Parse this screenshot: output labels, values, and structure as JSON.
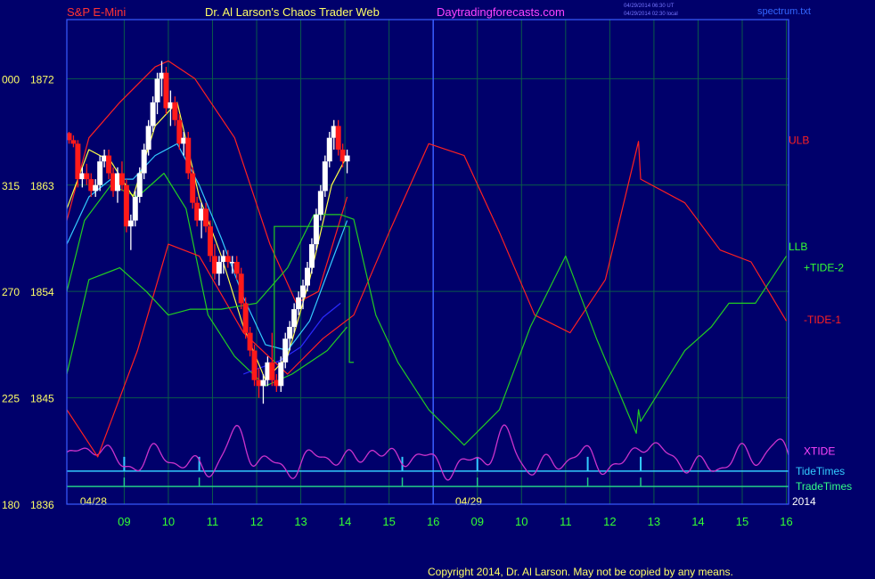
{
  "header": {
    "symbol": "S&P E-Mini",
    "title": "Dr. Al Larson's Chaos Trader Web",
    "site": "Daytradingforecasts.com",
    "timestamp_line1": "04/29/2014 06:30 UT",
    "timestamp_line2": "04/29/2014 02:30 local",
    "filename": "spectrum.txt"
  },
  "footer": {
    "copyright": "Copyright 2014, Dr. Al Larson. May not be copied by any means."
  },
  "colors": {
    "background": "#00006b",
    "frame": "#3a5cff",
    "grid": "#0a5a4a",
    "up_bar": "#ffffff",
    "down_bar": "#ff1a1a",
    "ulb": "#ff2020",
    "llb": "#22cc22",
    "tide": "#2a2aff",
    "xtide": "#cc33cc",
    "tidetimes": "#33ccff",
    "tradetimes": "#22cc88",
    "ma_fast": "#ffff44",
    "ma_mid": "#33ccff",
    "label_yellow": "#ffff66",
    "label_green": "#33ff33"
  },
  "chart_data": {
    "type": "line",
    "title": "S&P E-Mini",
    "y_axis": {
      "ticks": [
        {
          "code": "000",
          "price": 1872
        },
        {
          "code": "315",
          "price": 1863
        },
        {
          "code": "270",
          "price": 1854
        },
        {
          "code": "225",
          "price": 1845
        },
        {
          "code": "180",
          "price": 1836
        }
      ],
      "ylim": [
        1836,
        1877
      ]
    },
    "x_axis": {
      "hour_ticks": [
        {
          "label": "09",
          "t": 1.3
        },
        {
          "label": "10",
          "t": 2.3
        },
        {
          "label": "11",
          "t": 3.3
        },
        {
          "label": "12",
          "t": 4.3
        },
        {
          "label": "13",
          "t": 5.3
        },
        {
          "label": "14",
          "t": 6.3
        },
        {
          "label": "15",
          "t": 7.3
        },
        {
          "label": "16",
          "t": 8.3
        },
        {
          "label": "09",
          "t": 9.3
        },
        {
          "label": "10",
          "t": 10.3
        },
        {
          "label": "11",
          "t": 11.3
        },
        {
          "label": "12",
          "t": 12.3
        },
        {
          "label": "13",
          "t": 13.3
        },
        {
          "label": "14",
          "t": 14.3
        },
        {
          "label": "15",
          "t": 15.3
        },
        {
          "label": "16",
          "t": 16.3
        }
      ],
      "date_labels": [
        {
          "label": "04/28",
          "t": 0.3
        },
        {
          "label": "04/29",
          "t": 8.8
        }
      ],
      "year_label": "2014",
      "session_break_t": 8.3,
      "xlim": [
        0,
        16.35
      ]
    },
    "legend": [
      {
        "name": "ULB",
        "color": "#ff2020",
        "price": 1866.8
      },
      {
        "name": "LLB",
        "color": "#33ff33",
        "price": 1857.8
      },
      {
        "name": "+TIDE-2",
        "color": "#33ff33",
        "price": 1856.0
      },
      {
        "name": "-TIDE-1",
        "color": "#ff2020",
        "price": 1851.6
      },
      {
        "name": "XTIDE",
        "color": "#ff44ff",
        "price": 1840.5
      },
      {
        "name": "TideTimes",
        "color": "#33ccff",
        "price": 1838.8
      },
      {
        "name": "TradeTimes",
        "color": "#33ff88",
        "price": 1837.5
      }
    ],
    "price_bars": [
      [
        0.05,
        1867.5,
        1866.5,
        1867.4,
        1866.8
      ],
      [
        0.15,
        1867.2,
        1866.2,
        1866.8,
        1866.5
      ],
      [
        0.25,
        1866.8,
        1862.8,
        1866.5,
        1863.5
      ],
      [
        0.35,
        1864.5,
        1862.8,
        1863.5,
        1864.0
      ],
      [
        0.45,
        1864.8,
        1863.0,
        1864.0,
        1863.5
      ],
      [
        0.55,
        1864.0,
        1862.0,
        1863.5,
        1862.5
      ],
      [
        0.65,
        1863.5,
        1862.0,
        1862.5,
        1863.0
      ],
      [
        0.75,
        1865.5,
        1862.5,
        1863.0,
        1865.0
      ],
      [
        0.85,
        1866.0,
        1864.5,
        1865.0,
        1865.5
      ],
      [
        0.95,
        1866.0,
        1863.5,
        1865.5,
        1864.0
      ],
      [
        1.05,
        1864.5,
        1862.0,
        1864.0,
        1862.5
      ],
      [
        1.15,
        1864.5,
        1861.5,
        1862.5,
        1864.0
      ],
      [
        1.25,
        1865.0,
        1862.5,
        1864.0,
        1863.0
      ],
      [
        1.35,
        1863.5,
        1859.0,
        1863.0,
        1859.5
      ],
      [
        1.45,
        1860.5,
        1857.5,
        1859.5,
        1860.0
      ],
      [
        1.55,
        1862.5,
        1859.5,
        1860.0,
        1862.0
      ],
      [
        1.65,
        1864.5,
        1861.5,
        1862.0,
        1864.0
      ],
      [
        1.75,
        1866.5,
        1863.5,
        1864.0,
        1866.0
      ],
      [
        1.85,
        1868.5,
        1865.5,
        1866.0,
        1868.0
      ],
      [
        1.95,
        1870.5,
        1867.5,
        1868.0,
        1870.0
      ],
      [
        2.05,
        1872.5,
        1869.0,
        1870.0,
        1872.0
      ],
      [
        2.15,
        1873.5,
        1870.5,
        1872.0,
        1872.5
      ],
      [
        2.25,
        1873.0,
        1869.0,
        1872.5,
        1869.5
      ],
      [
        2.35,
        1871.0,
        1868.0,
        1869.5,
        1870.0
      ],
      [
        2.45,
        1870.5,
        1868.0,
        1870.0,
        1868.5
      ],
      [
        2.55,
        1869.0,
        1866.0,
        1868.5,
        1866.5
      ],
      [
        2.65,
        1867.5,
        1865.5,
        1866.5,
        1867.0
      ],
      [
        2.75,
        1867.5,
        1863.5,
        1867.0,
        1864.0
      ],
      [
        2.85,
        1864.5,
        1861.0,
        1864.0,
        1861.5
      ],
      [
        2.95,
        1862.0,
        1859.5,
        1861.5,
        1860.0
      ],
      [
        3.05,
        1861.5,
        1858.5,
        1860.0,
        1861.0
      ],
      [
        3.15,
        1861.5,
        1859.0,
        1861.0,
        1859.5
      ],
      [
        3.25,
        1860.0,
        1856.5,
        1859.5,
        1857.0
      ],
      [
        3.35,
        1858.0,
        1855.0,
        1857.0,
        1855.5
      ],
      [
        3.45,
        1857.0,
        1854.5,
        1855.5,
        1856.5
      ],
      [
        3.55,
        1857.5,
        1855.5,
        1856.5,
        1857.0
      ],
      [
        3.65,
        1857.5,
        1856.0,
        1857.0,
        1856.5
      ],
      [
        3.75,
        1857.0,
        1855.5,
        1856.5,
        1856.5
      ],
      [
        3.85,
        1857.0,
        1855.0,
        1856.5,
        1855.5
      ],
      [
        3.95,
        1856.0,
        1852.5,
        1855.5,
        1853.0
      ],
      [
        4.05,
        1853.5,
        1850.0,
        1853.0,
        1850.5
      ],
      [
        4.15,
        1851.0,
        1848.5,
        1850.5,
        1849.0
      ],
      [
        4.25,
        1849.5,
        1846.0,
        1849.0,
        1846.5
      ],
      [
        4.35,
        1847.5,
        1845.0,
        1846.5,
        1846.0
      ],
      [
        4.45,
        1847.0,
        1844.5,
        1846.0,
        1846.5
      ],
      [
        4.55,
        1848.5,
        1846.0,
        1846.5,
        1848.0
      ],
      [
        4.65,
        1850.5,
        1846.0,
        1848.0,
        1846.5
      ],
      [
        4.75,
        1847.0,
        1845.5,
        1846.5,
        1846.0
      ],
      [
        4.85,
        1848.5,
        1845.5,
        1846.0,
        1848.0
      ],
      [
        4.95,
        1850.5,
        1847.5,
        1848.0,
        1850.0
      ],
      [
        5.05,
        1851.5,
        1849.0,
        1850.0,
        1851.0
      ],
      [
        5.15,
        1853.0,
        1850.5,
        1851.0,
        1852.5
      ],
      [
        5.25,
        1854.0,
        1852.0,
        1852.5,
        1853.5
      ],
      [
        5.35,
        1855.0,
        1852.5,
        1853.5,
        1854.5
      ],
      [
        5.45,
        1856.5,
        1854.0,
        1854.5,
        1856.0
      ],
      [
        5.55,
        1858.5,
        1855.5,
        1856.0,
        1858.0
      ],
      [
        5.65,
        1861.0,
        1857.5,
        1858.0,
        1860.5
      ],
      [
        5.75,
        1863.0,
        1860.0,
        1860.5,
        1862.5
      ],
      [
        5.85,
        1865.5,
        1862.0,
        1862.5,
        1865.0
      ],
      [
        5.95,
        1867.5,
        1864.5,
        1865.0,
        1867.0
      ],
      [
        6.05,
        1868.5,
        1866.0,
        1867.0,
        1868.0
      ],
      [
        6.15,
        1868.5,
        1865.5,
        1868.0,
        1866.0
      ],
      [
        6.25,
        1866.5,
        1864.5,
        1866.0,
        1865.0
      ],
      [
        6.35,
        1866.0,
        1864.0,
        1865.0,
        1865.5
      ]
    ],
    "series": [
      {
        "name": "ULB",
        "color": "#ff2020",
        "x": [
          0,
          0.5,
          1.2,
          2.0,
          2.3,
          2.9,
          3.8,
          4.6,
          5.2,
          5.7,
          6.35
        ],
        "y": [
          1860,
          1867,
          1870,
          1873,
          1873.5,
          1872,
          1867,
          1858,
          1853,
          1854,
          1862
        ]
      },
      {
        "name": "LLB",
        "color": "#22cc22",
        "x": [
          0,
          0.4,
          1.0,
          1.6,
          2.2,
          2.7,
          3.2,
          3.8,
          4.5,
          5.1,
          5.9,
          6.35
        ],
        "y": [
          1854,
          1860,
          1863,
          1862,
          1864,
          1861,
          1852,
          1848.5,
          1846,
          1847,
          1849,
          1851
        ]
      },
      {
        "name": "Projection",
        "color": "#2a2aff",
        "x": [
          4.0,
          4.2,
          4.8,
          5.3,
          5.8,
          6.2
        ],
        "y": [
          1847,
          1847.3,
          1848.1,
          1849.3,
          1851.8,
          1853.0
        ]
      },
      {
        "name": "MA-fast",
        "color": "#ffff44",
        "x": [
          0,
          0.5,
          1.0,
          1.5,
          2.0,
          2.5,
          3.0,
          3.5,
          4.0,
          4.5,
          5.0,
          5.5,
          6.0,
          6.35
        ],
        "y": [
          1861,
          1866,
          1865,
          1862,
          1868,
          1870,
          1862,
          1857,
          1851,
          1846.5,
          1848.5,
          1855,
          1863,
          1865.5
        ]
      },
      {
        "name": "MA-mid",
        "color": "#33ccff",
        "x": [
          0,
          0.5,
          1.0,
          1.5,
          2.0,
          2.5,
          3.0,
          3.5,
          4.0,
          4.5,
          5.0,
          5.5,
          6.0,
          6.35
        ],
        "y": [
          1858,
          1862,
          1863.5,
          1863.5,
          1865.5,
          1866.5,
          1863,
          1858.5,
          1853.5,
          1849.5,
          1849,
          1851.5,
          1856.5,
          1860
        ]
      },
      {
        "name": "-TIDE-1",
        "color": "#ff2020",
        "x": [
          0,
          0.7,
          1.6,
          2.3,
          3.0,
          4.0,
          5.0,
          5.8,
          6.5,
          7.3,
          8.2,
          9.0,
          9.8,
          10.6,
          11.4,
          12.2,
          12.95,
          13.0,
          14.0,
          14.8,
          15.5,
          16.3
        ],
        "y": [
          1844,
          1840,
          1849,
          1858,
          1857,
          1850.5,
          1847,
          1850,
          1852,
          1859,
          1866.5,
          1865.5,
          1859,
          1852,
          1850.5,
          1855,
          1866.7,
          1863.5,
          1861.5,
          1857.5,
          1856.5,
          1851.5
        ]
      },
      {
        "name": "+TIDE-2",
        "color": "#22cc22",
        "x": [
          0,
          0.5,
          1.2,
          1.8,
          2.3,
          2.8,
          3.5,
          4.3,
          5.0,
          5.6,
          6.2,
          6.35,
          6.5,
          7.0,
          7.5,
          8.2,
          9.0,
          9.8,
          10.5,
          11.3,
          12.0,
          12.9,
          12.95,
          13.0,
          13.5,
          14.0,
          14.6,
          15.0,
          15.6,
          16.3
        ],
        "y": [
          1847,
          1855,
          1856,
          1854,
          1852,
          1852.5,
          1852.5,
          1853,
          1856,
          1860.5,
          1860.5,
          1860.3,
          1860.1,
          1852,
          1848,
          1844,
          1841,
          1844,
          1851,
          1857,
          1850,
          1842,
          1844,
          1843,
          1846,
          1849,
          1851,
          1853,
          1853,
          1857
        ]
      }
    ],
    "channel": {
      "color": "#22cc22",
      "rise_t": 4.7,
      "top_price": 1859.5,
      "bottom_price": 1848,
      "step_t": 6.4,
      "end_t": 6.5
    }
  }
}
